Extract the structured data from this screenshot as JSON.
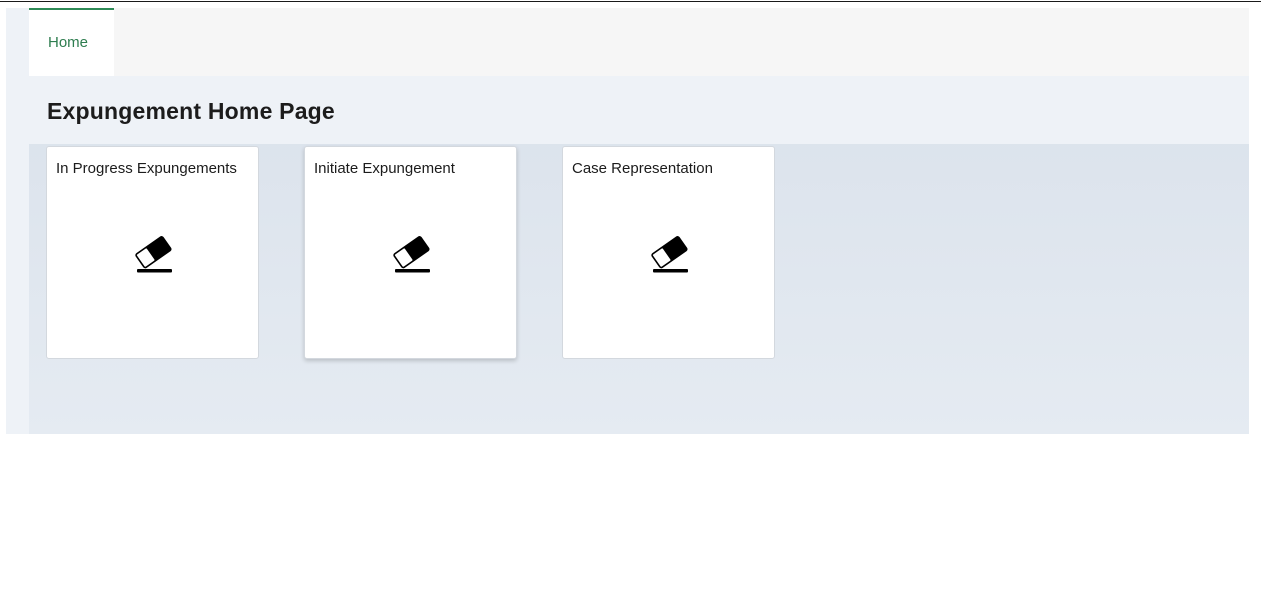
{
  "tabs": [
    {
      "label": "Home",
      "active": true
    }
  ],
  "page": {
    "title": "Expungement Home Page"
  },
  "tiles": [
    {
      "label": "In Progress Expungements",
      "icon": "eraser-icon"
    },
    {
      "label": "Initiate Expungement",
      "icon": "eraser-icon"
    },
    {
      "label": "Case Representation",
      "icon": "eraser-icon"
    }
  ],
  "colors": {
    "accent": "#2e8b57",
    "tab_text": "#2e7d4f",
    "content_bg": "#d8e0ea",
    "title_bar_bg": "#eef2f7"
  }
}
